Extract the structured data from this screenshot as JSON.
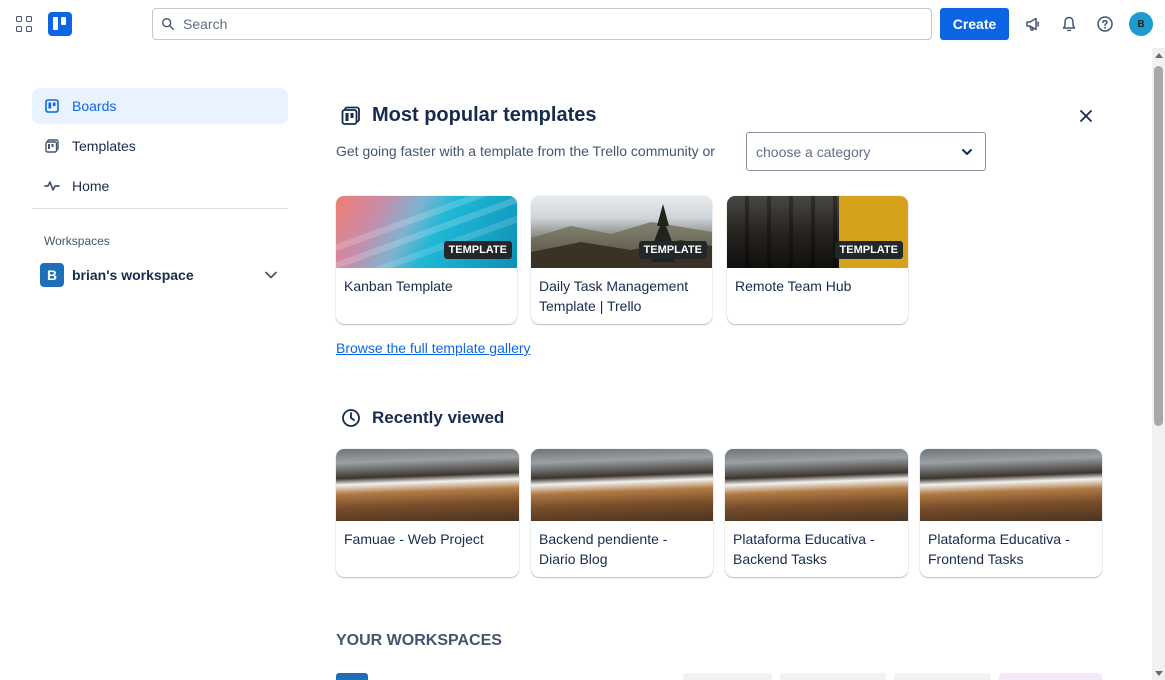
{
  "header": {
    "search_placeholder": "Search",
    "create_label": "Create",
    "avatar_initial": "B"
  },
  "sidebar": {
    "items": [
      {
        "label": "Boards",
        "icon": "board-icon",
        "active": true
      },
      {
        "label": "Templates",
        "icon": "template-icon",
        "active": false
      },
      {
        "label": "Home",
        "icon": "activity-icon",
        "active": false
      }
    ],
    "workspaces_heading": "Workspaces",
    "workspace": {
      "initial": "B",
      "name": "brian's workspace"
    }
  },
  "templates": {
    "title": "Most popular templates",
    "subtitle": "Get going faster with a template from the Trello community or",
    "category_placeholder": "choose a category",
    "badge": "TEMPLATE",
    "cards": [
      {
        "title": "Kanban Template"
      },
      {
        "title": "Daily Task Management Template | Trello"
      },
      {
        "title": "Remote Team Hub"
      }
    ],
    "browse_link": "Browse the full template gallery"
  },
  "recent": {
    "title": "Recently viewed",
    "cards": [
      {
        "title": "Famuae - Web Project"
      },
      {
        "title": "Backend pendiente - Diario Blog"
      },
      {
        "title": "Plataforma Educativa - Backend Tasks"
      },
      {
        "title": "Plataforma Educativa - Frontend Tasks"
      }
    ]
  },
  "your_workspaces": {
    "title": "YOUR WORKSPACES"
  },
  "colors": {
    "accent": "#0c66e4",
    "active_bg": "#e9f2ff",
    "text": "#172b4d",
    "muted": "#44546f"
  }
}
